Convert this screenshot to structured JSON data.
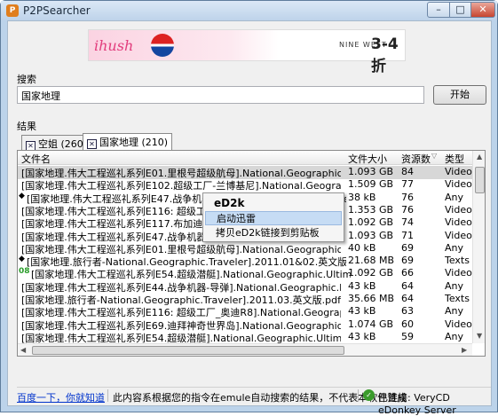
{
  "window": {
    "title": "P2PSearcher",
    "min_label": "–",
    "max_label": "□",
    "close_label": "✕",
    "app_icon": "P"
  },
  "ad": {
    "brand": "ihush",
    "brand_sub": "时尚社区.com",
    "nine_west": "NINE WEST",
    "sale": "3-4折"
  },
  "search": {
    "label": "搜索",
    "value": "国家地理",
    "button": "开始"
  },
  "results": {
    "label": "结果",
    "tabs": [
      {
        "label": "空姐 (260)"
      },
      {
        "label": "国家地理 (210)"
      }
    ],
    "columns": [
      "文件名",
      "文件大小",
      "资源数",
      "类型"
    ],
    "rows": [
      {
        "name": "[国家地理.伟大工程巡礼系列E01.里根号超级航母].National.Geographic.Megastructures.S",
        "size": "1.093 GB",
        "sources": "84",
        "type": "Videos",
        "mark": ""
      },
      {
        "name": "[国家地理.伟大工程巡礼系列E102.超级工厂-兰博基尼].National.Geographic.Megastructures.Fact",
        "size": "1.509 GB",
        "sources": "77",
        "type": "Videos",
        "mark": ""
      },
      {
        "name": "[国家地理.伟大工程巡礼系列E47.战争机器-枪].National.Geographic.Megastructures.Ma",
        "size": "38 kB",
        "sources": "76",
        "type": "Any",
        "mark": "◆"
      },
      {
        "name": "[国家地理.伟大工程巡礼系列E116: 超级工厂-奥迪R8].National.Geographic.Ultimate.Facto",
        "size": "1.353 GB",
        "sources": "76",
        "type": "Videos",
        "mark": ""
      },
      {
        "name": "[国家地理.伟大工程巡礼系列E117.布加迪超级跑车].National.Geographic.Man.Made.Bugat",
        "size": "1.092 GB",
        "sources": "74",
        "type": "Videos",
        "mark": ""
      },
      {
        "name": "[国家地理.伟大工程巡礼系列E47.战争机器-枪].National.Geographic.Megastructures.Macl",
        "size": "1.093 GB",
        "sources": "71",
        "type": "Videos",
        "mark": ""
      },
      {
        "name": "[国家地理.伟大工程巡礼系列E01.里根号超级航母].National.Geographic.Megastructures.S",
        "size": "40 kB",
        "sources": "69",
        "type": "Any",
        "mark": ""
      },
      {
        "name": "[国家地理.旅行者-National.Geographic.Traveler].2011.01&02.英文版.pdf",
        "size": "21.68 MB",
        "sources": "69",
        "type": "Texts",
        "mark": "◆"
      },
      {
        "name": "[国家地理.伟大工程巡礼系列E54.超级潜艇].National.Geographic.Ultimate.Structures",
        "size": "1.092 GB",
        "sources": "66",
        "type": "Videos",
        "mark": "08"
      },
      {
        "name": "[国家地理.伟大工程巡礼系列E44.战争机器-导弹].National.Geographic.Megastructures.M",
        "size": "43 kB",
        "sources": "64",
        "type": "Any",
        "mark": ""
      },
      {
        "name": "[国家地理.旅行者-National.Geographic.Traveler].2011.03.英文版.pdf",
        "size": "35.66 MB",
        "sources": "64",
        "type": "Texts",
        "mark": ""
      },
      {
        "name": "[国家地理.伟大工程巡礼系列E116: 超级工厂_奥迪R8].National.Geographic.Ultimate.Facto",
        "size": "43 kB",
        "sources": "63",
        "type": "Any",
        "mark": ""
      },
      {
        "name": "[国家地理.伟大工程巡礼系列E69.迪拜神奇世界岛].National.Geographic.Megastructures.\\",
        "size": "1.074 GB",
        "sources": "60",
        "type": "Videos",
        "mark": ""
      },
      {
        "name": "[国家地理.伟大工程巡礼系列E54.超级潜艇].National.Geographic.Ultimate.Structures.Sup",
        "size": "43 kB",
        "sources": "59",
        "type": "Any",
        "mark": ""
      }
    ]
  },
  "context_menu": {
    "title": "eD2k",
    "items": [
      "启动迅雷",
      "拷贝eD2k链接到剪贴板"
    ]
  },
  "status": {
    "link": "百度一下，你就知道",
    "message": "此内容系根据您的指令在emule自动搜索的结果，不代表本软件赞成",
    "connection": "已连接: VeryCD eDonkey Server"
  },
  "colors": {
    "selected_row": "#d7d7d7",
    "menu_highlight": "#c6dcf4",
    "link": "#0033cc"
  }
}
